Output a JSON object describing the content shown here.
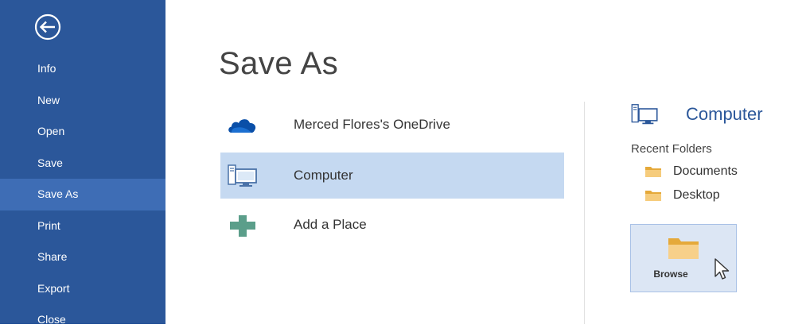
{
  "sidebar": {
    "background": "#2b579a",
    "active_background": "#3e6db5",
    "back_icon": "back-arrow-circle-icon",
    "items": [
      {
        "label": "Info",
        "active": false
      },
      {
        "label": "New",
        "active": false
      },
      {
        "label": "Open",
        "active": false
      },
      {
        "label": "Save",
        "active": false
      },
      {
        "label": "Save As",
        "active": true
      },
      {
        "label": "Print",
        "active": false
      },
      {
        "label": "Share",
        "active": false
      },
      {
        "label": "Export",
        "active": false
      },
      {
        "label": "Close",
        "active": false
      }
    ]
  },
  "main": {
    "title": "Save As",
    "places": [
      {
        "label": "Merced Flores's OneDrive",
        "icon": "onedrive-cloud-icon",
        "selected": false
      },
      {
        "label": "Computer",
        "icon": "computer-icon",
        "selected": true
      },
      {
        "label": "Add a Place",
        "icon": "add-plus-icon",
        "selected": false
      }
    ]
  },
  "detail": {
    "title": "Computer",
    "icon": "computer-icon",
    "recent_label": "Recent Folders",
    "folders": [
      {
        "label": "Documents",
        "icon": "folder-icon"
      },
      {
        "label": "Desktop",
        "icon": "folder-icon"
      }
    ],
    "browse_label": "Browse",
    "browse_icon": "folder-icon"
  },
  "colors": {
    "accent": "#2b579a",
    "selected_place": "#c5d9f1",
    "browse_bg": "#dce6f4",
    "folder": "#f4c872",
    "add_plus": "#5b9e8a"
  }
}
